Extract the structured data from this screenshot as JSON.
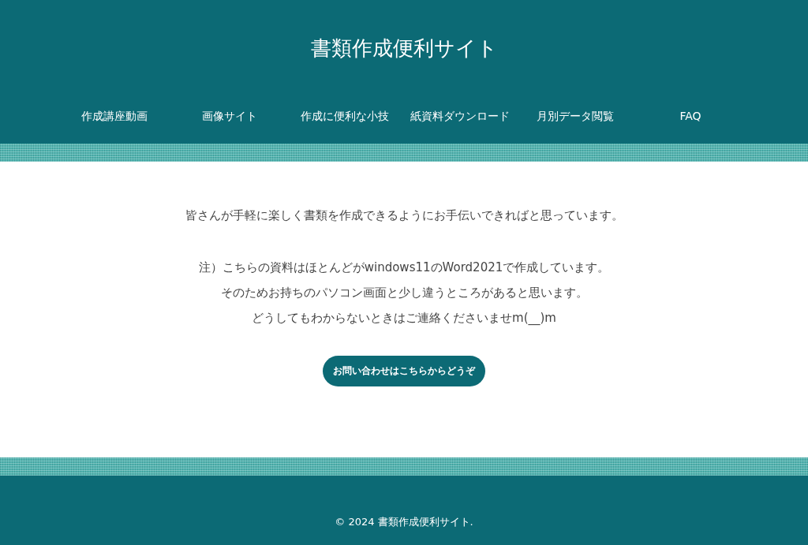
{
  "site_title": "書類作成便利サイト",
  "nav": [
    "作成講座動画",
    "画像サイト",
    "作成に便利な小技",
    "紙資料ダウンロード",
    "月別データ閲覧",
    "FAQ"
  ],
  "intro": "皆さんが手軽に楽しく書類を作成できるようにお手伝いできればと思っています。",
  "notes": [
    "注）こちらの資料はほとんどがwindows11のWord2021で作成しています。",
    "そのためお持ちのパソコン画面と少し違うところがあると思います。",
    "どうしてもわからないときはご連絡くださいませm(__)m"
  ],
  "contact_button": "お問い合わせはこちらからどうぞ",
  "footer": "© 2024 書類作成便利サイト."
}
